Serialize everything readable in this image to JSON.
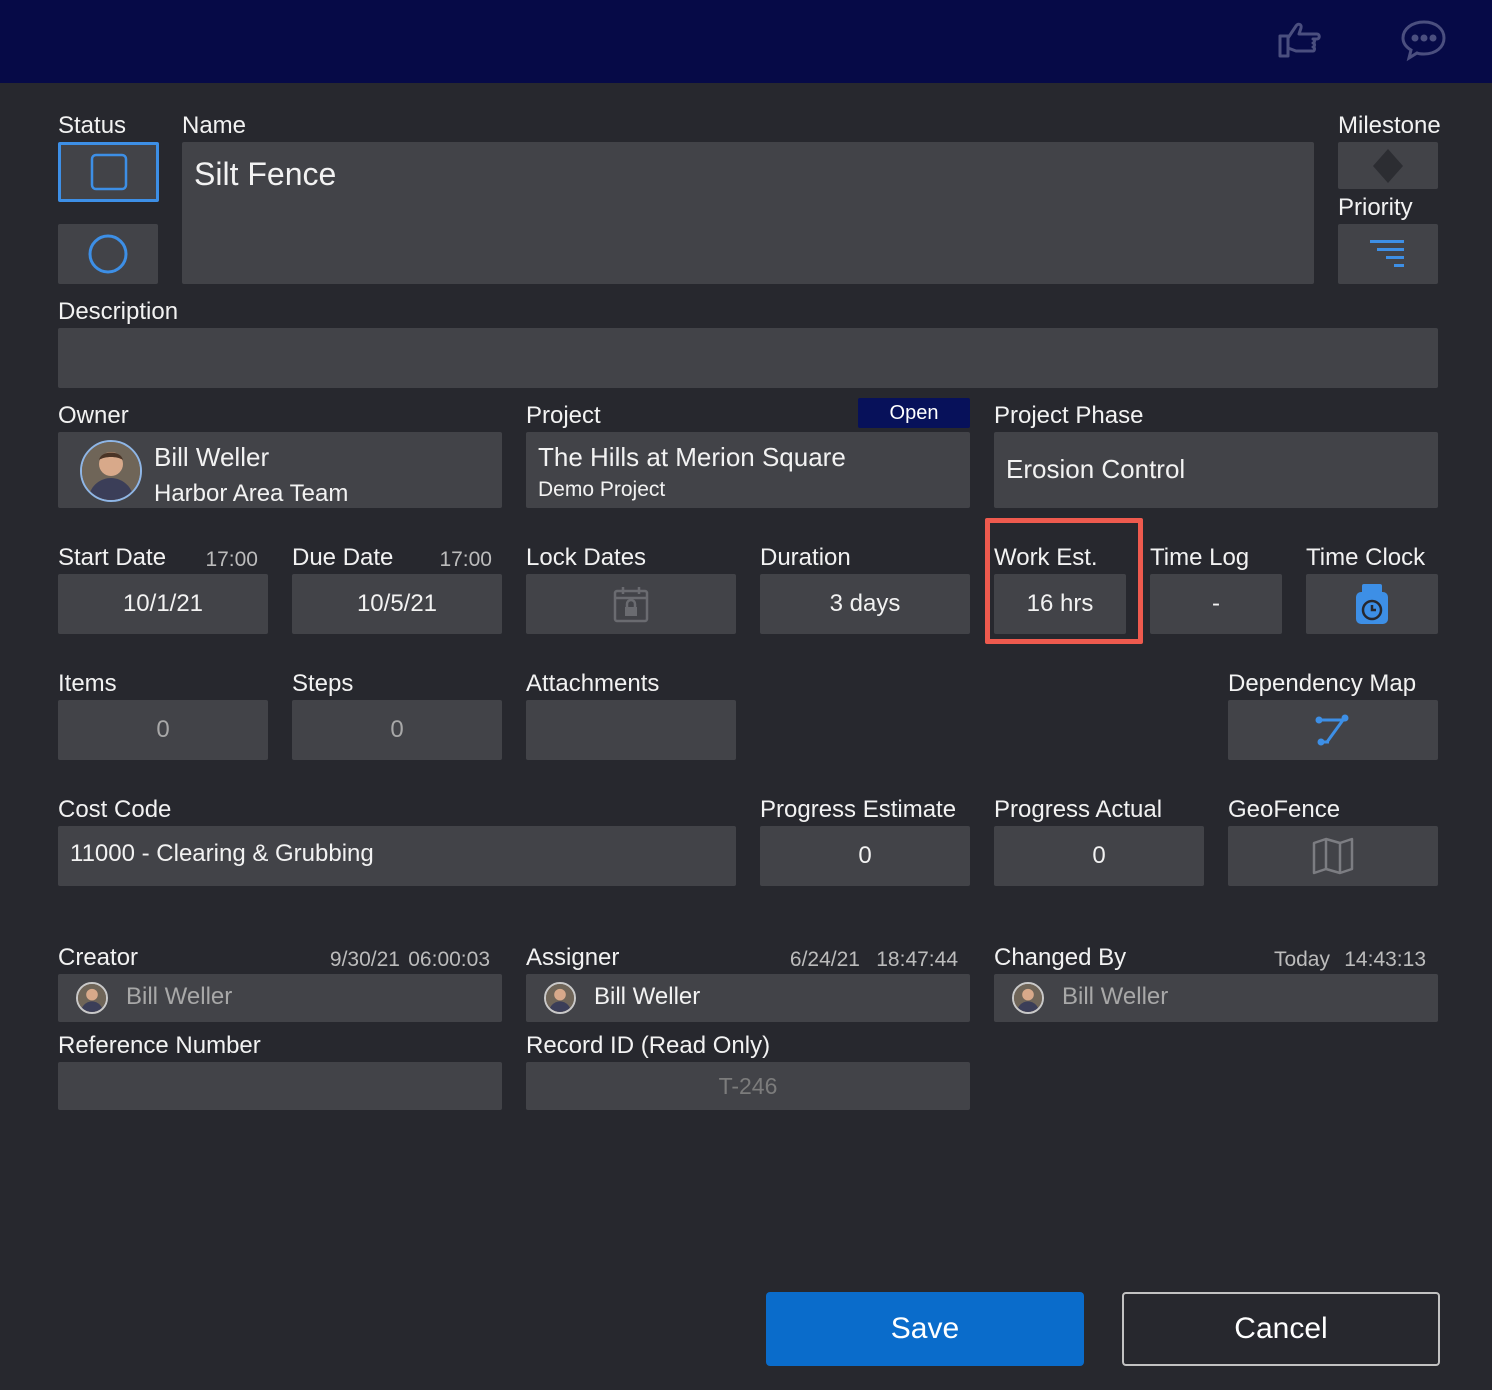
{
  "header": {
    "icons": [
      "thumbs-up-pointing-icon",
      "chat-bubble-icon"
    ]
  },
  "status": {
    "label": "Status"
  },
  "name": {
    "label": "Name",
    "value": "Silt Fence"
  },
  "milestone": {
    "label": "Milestone"
  },
  "priority": {
    "label": "Priority"
  },
  "description": {
    "label": "Description",
    "value": ""
  },
  "owner": {
    "label": "Owner",
    "name": "Bill Weller",
    "team": "Harbor Area Team"
  },
  "project": {
    "label": "Project",
    "badge": "Open",
    "name": "The Hills at Merion Square",
    "sub": "Demo Project"
  },
  "project_phase": {
    "label": "Project Phase",
    "value": "Erosion Control"
  },
  "start_date": {
    "label": "Start Date",
    "time": "17:00",
    "value": "10/1/21"
  },
  "due_date": {
    "label": "Due Date",
    "time": "17:00",
    "value": "10/5/21"
  },
  "lock_dates": {
    "label": "Lock Dates"
  },
  "duration": {
    "label": "Duration",
    "value": "3 days"
  },
  "work_est": {
    "label": "Work Est.",
    "value": "16 hrs"
  },
  "time_log": {
    "label": "Time Log",
    "value": "-"
  },
  "time_clock": {
    "label": "Time Clock"
  },
  "items": {
    "label": "Items",
    "value": "0"
  },
  "steps": {
    "label": "Steps",
    "value": "0"
  },
  "attachments": {
    "label": "Attachments",
    "value": ""
  },
  "dependency_map": {
    "label": "Dependency Map"
  },
  "cost_code": {
    "label": "Cost Code",
    "value": "11000 - Clearing & Grubbing"
  },
  "progress_estimate": {
    "label": "Progress Estimate",
    "value": "0"
  },
  "progress_actual": {
    "label": "Progress Actual",
    "value": "0"
  },
  "geofence": {
    "label": "GeoFence"
  },
  "creator": {
    "label": "Creator",
    "date": "9/30/21",
    "time": "06:00:03",
    "name": "Bill Weller"
  },
  "assigner": {
    "label": "Assigner",
    "date": "6/24/21",
    "time": "18:47:44",
    "name": "Bill Weller"
  },
  "changed_by": {
    "label": "Changed By",
    "date": "Today",
    "time": "14:43:13",
    "name": "Bill Weller"
  },
  "reference_number": {
    "label": "Reference Number",
    "value": ""
  },
  "record_id": {
    "label": "Record ID (Read Only)",
    "value": "T-246"
  },
  "actions": {
    "save": "Save",
    "cancel": "Cancel"
  },
  "colors": {
    "accent": "#3d8fe6",
    "save_button": "#0a6ccb",
    "header": "#060a47",
    "highlight": "#ee5a4e",
    "badge": "#07115a"
  }
}
